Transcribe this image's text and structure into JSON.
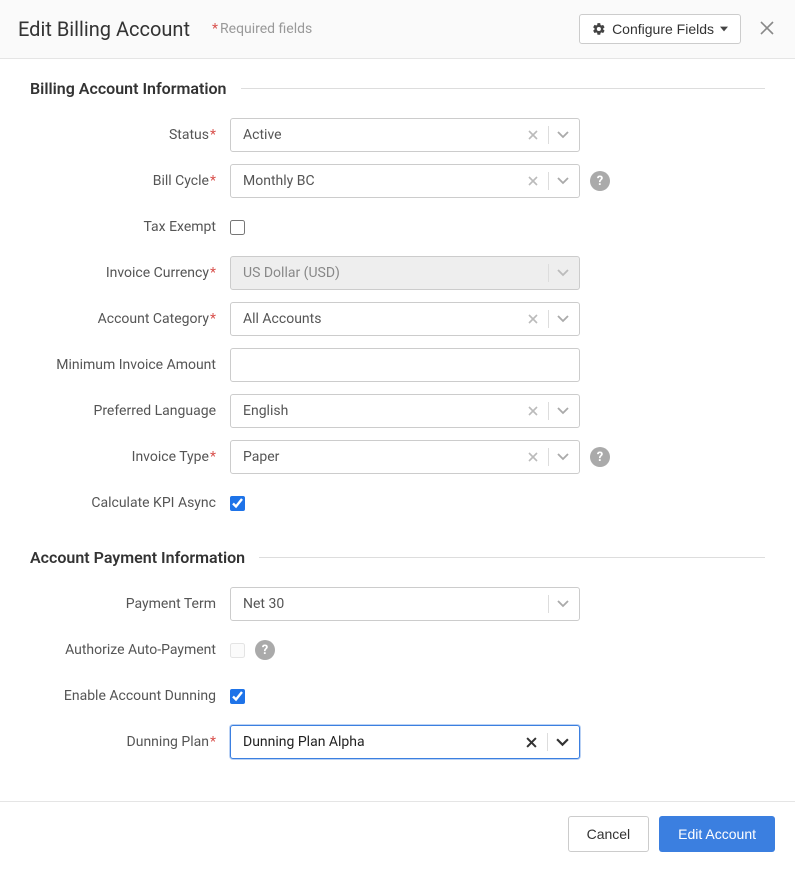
{
  "header": {
    "title": "Edit Billing Account",
    "required_hint": "Required fields",
    "configure_label": "Configure Fields"
  },
  "sections": {
    "billing_info": {
      "title": "Billing Account Information",
      "fields": {
        "status": {
          "label": "Status",
          "value": "Active"
        },
        "bill_cycle": {
          "label": "Bill Cycle",
          "value": "Monthly BC"
        },
        "tax_exempt": {
          "label": "Tax Exempt",
          "checked": false
        },
        "invoice_currency": {
          "label": "Invoice Currency",
          "value": "US Dollar (USD)"
        },
        "account_category": {
          "label": "Account Category",
          "value": "All Accounts"
        },
        "min_invoice_amount": {
          "label": "Minimum Invoice Amount",
          "value": ""
        },
        "preferred_language": {
          "label": "Preferred Language",
          "value": "English"
        },
        "invoice_type": {
          "label": "Invoice Type",
          "value": "Paper"
        },
        "calculate_kpi_async": {
          "label": "Calculate KPI Async",
          "checked": true
        }
      }
    },
    "payment_info": {
      "title": "Account Payment Information",
      "fields": {
        "payment_term": {
          "label": "Payment Term",
          "value": "Net 30"
        },
        "authorize_auto_payment": {
          "label": "Authorize Auto-Payment",
          "checked": false
        },
        "enable_account_dunning": {
          "label": "Enable Account Dunning",
          "checked": true
        },
        "dunning_plan": {
          "label": "Dunning Plan",
          "value": "Dunning Plan Alpha"
        }
      }
    }
  },
  "footer": {
    "cancel_label": "Cancel",
    "submit_label": "Edit Account"
  }
}
